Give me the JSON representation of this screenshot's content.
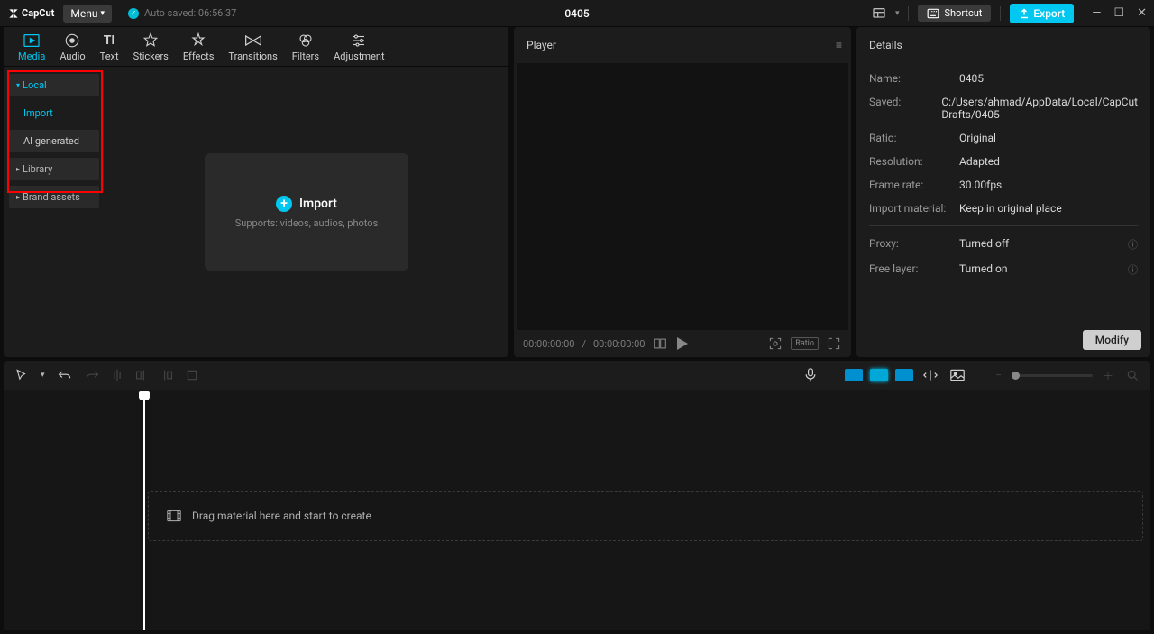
{
  "app": {
    "name": "CapCut",
    "menu_label": "Menu",
    "autosave_label": "Auto saved: 06:56:37",
    "project_title": "0405",
    "shortcut_label": "Shortcut",
    "export_label": "Export"
  },
  "top_tabs": [
    {
      "label": "Media",
      "active": true
    },
    {
      "label": "Audio",
      "active": false
    },
    {
      "label": "Text",
      "active": false
    },
    {
      "label": "Stickers",
      "active": false
    },
    {
      "label": "Effects",
      "active": false
    },
    {
      "label": "Transitions",
      "active": false
    },
    {
      "label": "Filters",
      "active": false
    },
    {
      "label": "Adjustment",
      "active": false
    }
  ],
  "media_sidebar": {
    "local": "Local",
    "import": "Import",
    "ai": "AI generated",
    "library": "Library",
    "brand": "Brand assets"
  },
  "import_box": {
    "title": "Import",
    "subtitle": "Supports: videos, audios, photos"
  },
  "player": {
    "title": "Player",
    "time_current": "00:00:00:00",
    "time_total": "00:00:00:00"
  },
  "details": {
    "title": "Details",
    "rows": {
      "name_label": "Name:",
      "name_value": "0405",
      "saved_label": "Saved:",
      "saved_value": "C:/Users/ahmad/AppData/Local/CapCut Drafts/0405",
      "ratio_label": "Ratio:",
      "ratio_value": "Original",
      "resolution_label": "Resolution:",
      "resolution_value": "Adapted",
      "framerate_label": "Frame rate:",
      "framerate_value": "30.00fps",
      "import_label": "Import material:",
      "import_value": "Keep in original place",
      "proxy_label": "Proxy:",
      "proxy_value": "Turned off",
      "freelayer_label": "Free layer:",
      "freelayer_value": "Turned on"
    },
    "modify_label": "Modify"
  },
  "timeline": {
    "drop_hint": "Drag material here and start to create"
  }
}
